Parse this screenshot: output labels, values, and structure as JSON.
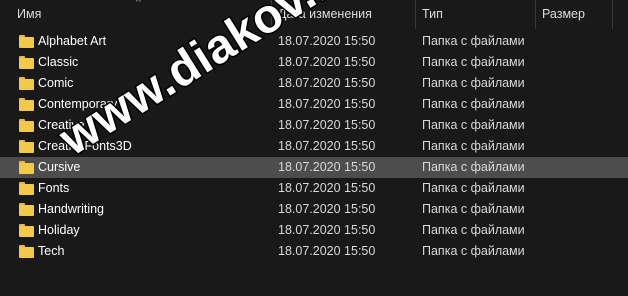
{
  "header": {
    "name": "Имя",
    "date": "Дата изменения",
    "type": "Тип",
    "size": "Размер",
    "sort_indicator": "^"
  },
  "rows": [
    {
      "name": "Alphabet Art",
      "date": "18.07.2020 15:50",
      "type": "Папка с файлами",
      "icon": "folder-icon"
    },
    {
      "name": "Classic",
      "date": "18.07.2020 15:50",
      "type": "Папка с файлами",
      "icon": "folder-icon"
    },
    {
      "name": "Comic",
      "date": "18.07.2020 15:50",
      "type": "Папка с файлами",
      "icon": "folder-icon"
    },
    {
      "name": "Contemporary",
      "date": "18.07.2020 15:50",
      "type": "Папка с файлами",
      "icon": "folder-icon"
    },
    {
      "name": "Creative",
      "date": "18.07.2020 15:50",
      "type": "Папка с файлами",
      "icon": "folder-icon"
    },
    {
      "name": "CreativeFonts3D",
      "date": "18.07.2020 15:50",
      "type": "Папка с файлами",
      "icon": "folder-icon"
    },
    {
      "name": "Cursive",
      "date": "18.07.2020 15:50",
      "type": "Папка с файлами",
      "icon": "folder-icon",
      "selected": true
    },
    {
      "name": "Fonts",
      "date": "18.07.2020 15:50",
      "type": "Папка с файлами",
      "icon": "folder-icon"
    },
    {
      "name": "Handwriting",
      "date": "18.07.2020 15:50",
      "type": "Папка с файлами",
      "icon": "folder-icon"
    },
    {
      "name": "Holiday",
      "date": "18.07.2020 15:50",
      "type": "Папка с файлами",
      "icon": "folder-icon"
    },
    {
      "name": "Tech",
      "date": "18.07.2020 15:50",
      "type": "Папка с файлами",
      "icon": "folder-icon"
    }
  ],
  "watermark": "www.diakov.net",
  "colors": {
    "background": "#191919",
    "selected_row": "#4d4d4d",
    "folder": "#f2c94a"
  }
}
